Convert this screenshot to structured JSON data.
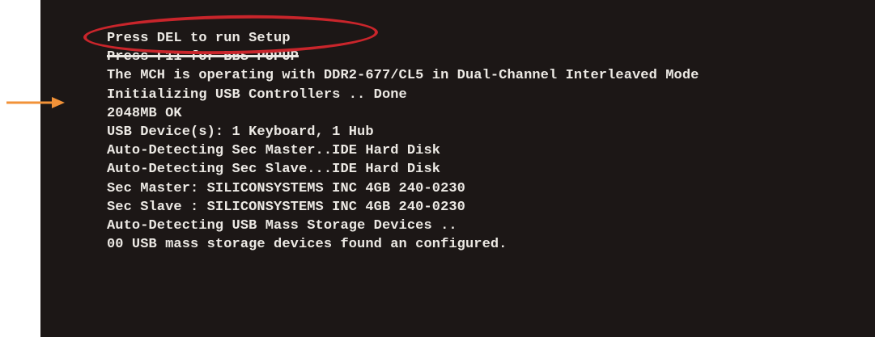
{
  "colors": {
    "terminal_bg": "#1c1716",
    "text": "#ece9e4",
    "highlight": "#c9252b",
    "arrow": "#f29238"
  },
  "terminal": {
    "lines": [
      "Press DEL to run Setup",
      "Press F11 for BBS POPUP",
      "The MCH is operating with DDR2-677/CL5 in Dual-Channel Interleaved Mode",
      "Initializing USB Controllers .. Done",
      "2048MB OK",
      "USB Device(s): 1 Keyboard, 1 Hub",
      "Auto-Detecting Sec Master..IDE Hard Disk",
      "Auto-Detecting Sec Slave...IDE Hard Disk",
      "Sec Master: SILICONSYSTEMS INC 4GB 240-0230",
      "Sec Slave : SILICONSYSTEMS INC 4GB 240-0230",
      "Auto-Detecting USB Mass Storage Devices ..",
      "00 USB mass storage devices found an configured."
    ]
  },
  "annotations": {
    "circled_line_index": 0,
    "arrow_line_index": 3,
    "struck_line_index": 1
  }
}
